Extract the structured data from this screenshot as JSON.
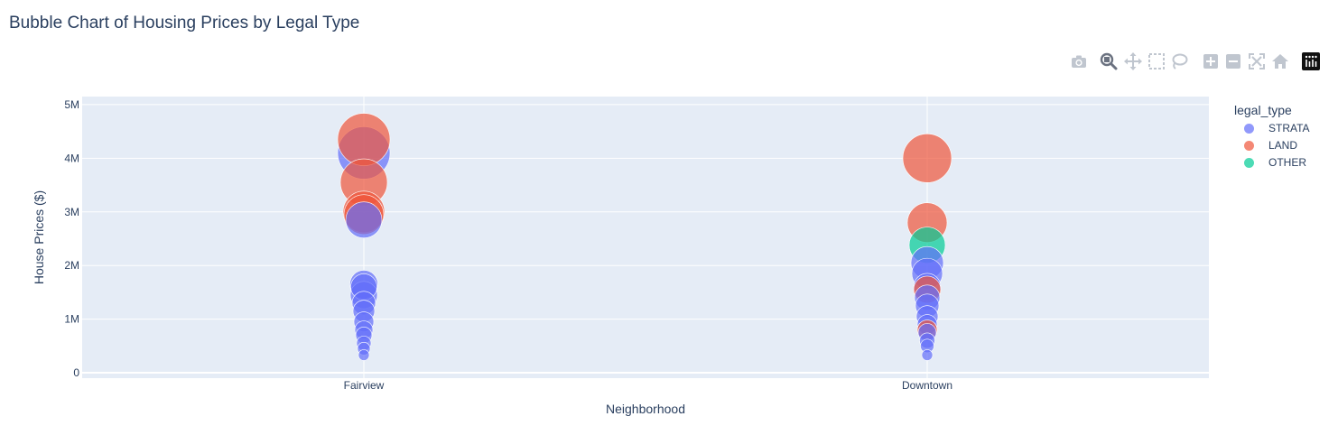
{
  "title": "Bubble Chart of Housing Prices by Legal Type",
  "modebar": {
    "icons": [
      "camera-icon",
      "zoom-icon",
      "pan-icon",
      "box-select-icon",
      "lasso-icon",
      "zoom-in-icon",
      "zoom-out-icon",
      "autoscale-icon",
      "home-icon",
      "plotly-logo-icon"
    ]
  },
  "legend": {
    "title": "legal_type",
    "items": [
      {
        "label": "STRATA",
        "color": "#636efa"
      },
      {
        "label": "LAND",
        "color": "#EF553B"
      },
      {
        "label": "OTHER",
        "color": "#00cc96"
      }
    ]
  },
  "chart_data": {
    "type": "scatter",
    "title": "Bubble Chart of Housing Prices by Legal Type",
    "xlabel": "Neighborhood",
    "ylabel": "House Prices ($)",
    "categories": [
      "Fairview",
      "Downtown"
    ],
    "ylim": [
      -100000,
      5150000
    ],
    "yticks": [
      0,
      1000000,
      2000000,
      3000000,
      4000000,
      5000000
    ],
    "ytick_labels": [
      "0",
      "1M",
      "2M",
      "3M",
      "4M",
      "5M"
    ],
    "plot_bgcolor": "#e5ecf6",
    "series": [
      {
        "name": "STRATA",
        "color": "#636efa",
        "points": [
          {
            "x": "Fairview",
            "y": 4100000,
            "size": 58
          },
          {
            "x": "Fairview",
            "y": 2850000,
            "size": 40
          },
          {
            "x": "Fairview",
            "y": 1650000,
            "size": 31
          },
          {
            "x": "Fairview",
            "y": 1600000,
            "size": 29
          },
          {
            "x": "Fairview",
            "y": 1450000,
            "size": 30
          },
          {
            "x": "Fairview",
            "y": 1300000,
            "size": 26
          },
          {
            "x": "Fairview",
            "y": 1150000,
            "size": 24
          },
          {
            "x": "Fairview",
            "y": 950000,
            "size": 22
          },
          {
            "x": "Fairview",
            "y": 800000,
            "size": 20
          },
          {
            "x": "Fairview",
            "y": 700000,
            "size": 18
          },
          {
            "x": "Fairview",
            "y": 550000,
            "size": 16
          },
          {
            "x": "Fairview",
            "y": 450000,
            "size": 14
          },
          {
            "x": "Fairview",
            "y": 330000,
            "size": 12
          },
          {
            "x": "Downtown",
            "y": 2050000,
            "size": 36
          },
          {
            "x": "Downtown",
            "y": 1850000,
            "size": 34
          },
          {
            "x": "Downtown",
            "y": 1600000,
            "size": 30
          },
          {
            "x": "Downtown",
            "y": 1400000,
            "size": 28
          },
          {
            "x": "Downtown",
            "y": 1250000,
            "size": 26
          },
          {
            "x": "Downtown",
            "y": 1050000,
            "size": 24
          },
          {
            "x": "Downtown",
            "y": 900000,
            "size": 22
          },
          {
            "x": "Downtown",
            "y": 750000,
            "size": 20
          },
          {
            "x": "Downtown",
            "y": 600000,
            "size": 17
          },
          {
            "x": "Downtown",
            "y": 500000,
            "size": 15
          },
          {
            "x": "Downtown",
            "y": 330000,
            "size": 12
          }
        ]
      },
      {
        "name": "LAND",
        "color": "#EF553B",
        "points": [
          {
            "x": "Fairview",
            "y": 4350000,
            "size": 58
          },
          {
            "x": "Fairview",
            "y": 3550000,
            "size": 52
          },
          {
            "x": "Fairview",
            "y": 3000000,
            "size": 46
          },
          {
            "x": "Fairview",
            "y": 2950000,
            "size": 44
          },
          {
            "x": "Downtown",
            "y": 4000000,
            "size": 54
          },
          {
            "x": "Downtown",
            "y": 2800000,
            "size": 44
          },
          {
            "x": "Downtown",
            "y": 1550000,
            "size": 30
          },
          {
            "x": "Downtown",
            "y": 800000,
            "size": 22
          }
        ]
      },
      {
        "name": "OTHER",
        "color": "#00cc96",
        "points": [
          {
            "x": "Downtown",
            "y": 2380000,
            "size": 40
          }
        ]
      }
    ]
  }
}
